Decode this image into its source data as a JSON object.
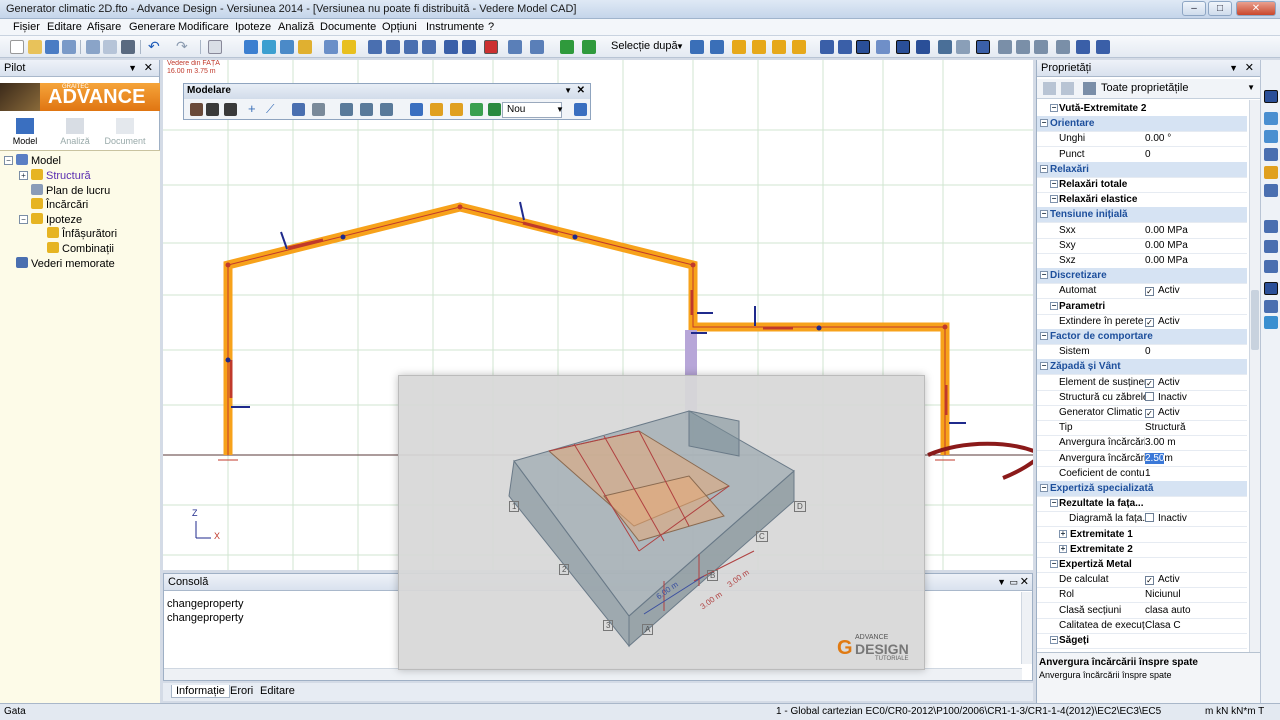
{
  "window": {
    "title": "Generator climatic 2D.fto - Advance Design - Versiunea 2014 - [Versiunea nu poate fi distribuită - Vedere Model CAD]",
    "buttons": [
      "–",
      "□",
      "✕"
    ]
  },
  "menu": [
    "Fișier",
    "Editare",
    "Afișare",
    "Generare",
    "Modificare",
    "Ipoteze",
    "Analiză",
    "Documente",
    "Opțiuni",
    "Instrumente",
    "?"
  ],
  "toolbar": {
    "selection_combo": "Selecție după"
  },
  "pilot": {
    "title": "Pilot",
    "brand_small": "GRAITEC",
    "brand": "ADVANCE",
    "tabs": [
      "Model",
      "Analiză",
      "Document"
    ],
    "tree": [
      {
        "label": "Model",
        "level": 0
      },
      {
        "label": "Structură",
        "level": 1
      },
      {
        "label": "Plan de lucru",
        "level": 1
      },
      {
        "label": "Încărcări",
        "level": 1
      },
      {
        "label": "Ipoteze",
        "level": 1
      },
      {
        "label": "Înfășurători",
        "level": 2
      },
      {
        "label": "Combinații",
        "level": 2
      },
      {
        "label": "Vederi memorate",
        "level": 0
      }
    ]
  },
  "viewport": {
    "view_name": "Vedere din FAȚĂ",
    "view_size": "16.00 m  3.75 m",
    "axis_z": "Z",
    "axis_x": "X"
  },
  "modelare": {
    "title": "Modelare",
    "combo_value": "Nou"
  },
  "console": {
    "title": "Consolă",
    "lines": [
      "changeproperty",
      "changeproperty"
    ],
    "tabs": [
      "Informație",
      "Erori",
      "Editare"
    ]
  },
  "overlay": {
    "labels": [
      "1",
      "2",
      "3",
      "A",
      "B",
      "C",
      "D"
    ],
    "dim1": "6.00 m",
    "dim2": "3.00 m",
    "dim3": "3.00 m",
    "logo_small": "ADVANCE",
    "logo_big": "DESIGN",
    "logo_sub": "TUTORIALE"
  },
  "properties": {
    "title": "Proprietăți",
    "filter": "Toate proprietățile",
    "rows": [
      {
        "type": "sub",
        "name": "Vută-Extremitate 2"
      },
      {
        "type": "cat",
        "name": "Orientare"
      },
      {
        "type": "prop",
        "name": "Unghi",
        "value": "0.00 °"
      },
      {
        "type": "prop",
        "name": "Punct",
        "value": "0"
      },
      {
        "type": "cat",
        "name": "Relaxări"
      },
      {
        "type": "sub",
        "name": "Relaxări totale"
      },
      {
        "type": "sub",
        "name": "Relaxări elastice"
      },
      {
        "type": "cat",
        "name": "Tensiune inițială"
      },
      {
        "type": "prop",
        "name": "Sxx",
        "value": "0.00 MPa"
      },
      {
        "type": "prop",
        "name": "Sxy",
        "value": "0.00 MPa"
      },
      {
        "type": "prop",
        "name": "Sxz",
        "value": "0.00 MPa"
      },
      {
        "type": "cat",
        "name": "Discretizare"
      },
      {
        "type": "check",
        "name": "Automat",
        "value": "Activ",
        "checked": true
      },
      {
        "type": "sub",
        "name": "Parametri"
      },
      {
        "type": "check",
        "name": "Extindere în perete",
        "value": "Activ",
        "checked": true
      },
      {
        "type": "cat",
        "name": "Factor de comportare"
      },
      {
        "type": "prop",
        "name": "Sistem",
        "value": "0"
      },
      {
        "type": "cat",
        "name": "Zăpadă și Vânt"
      },
      {
        "type": "check",
        "name": "Element de susținere",
        "value": "Activ",
        "checked": true
      },
      {
        "type": "check",
        "name": "Structură cu zăbrele",
        "value": "Inactiv",
        "checked": false
      },
      {
        "type": "check",
        "name": "Generator Climatic",
        "value": "Activ",
        "checked": true
      },
      {
        "type": "prop",
        "name": "Tip",
        "value": "Structură"
      },
      {
        "type": "prop",
        "name": "Anvergura încărcării",
        "value": "3.00 m"
      },
      {
        "type": "edit",
        "name": "Anvergura încărcării",
        "value": "2.50",
        "suffix": "m"
      },
      {
        "type": "prop",
        "name": "Coeficient de contur",
        "value": "1"
      },
      {
        "type": "cat",
        "name": "Expertiză specializată"
      },
      {
        "type": "sub",
        "name": "Rezultate la fața..."
      },
      {
        "type": "check",
        "name": "Diagramă la fața...",
        "value": "Inactiv",
        "checked": false,
        "indent": true
      },
      {
        "type": "sub2",
        "name": "Extremitate 1"
      },
      {
        "type": "sub2",
        "name": "Extremitate 2"
      },
      {
        "type": "sub",
        "name": "Expertiză Metal"
      },
      {
        "type": "check",
        "name": "De calculat",
        "value": "Activ",
        "checked": true
      },
      {
        "type": "prop",
        "name": "Rol",
        "value": "Niciunul"
      },
      {
        "type": "prop",
        "name": "Clasă secțiuni",
        "value": "clasa auto"
      },
      {
        "type": "prop",
        "name": "Calitatea de execuție",
        "value": "Clasa C"
      },
      {
        "type": "sub",
        "name": "Săgeți"
      }
    ],
    "desc_title": "Anvergura încărcării înspre spate",
    "desc_text": "Anvergura încărcării înspre spate"
  },
  "status": {
    "left": "Gata",
    "right": "1 - Global cartezian   EC0/CR0-2012\\P100/2006\\CR1-1-3/CR1-1-4(2012)\\EC2\\EC3\\EC5",
    "units": "m  kN  kN*m  T"
  },
  "colors": {
    "beam": "#f7a21b",
    "beam_axis": "#c0392b",
    "release": "#1f2a8c",
    "accent": "#1d4f9c"
  }
}
